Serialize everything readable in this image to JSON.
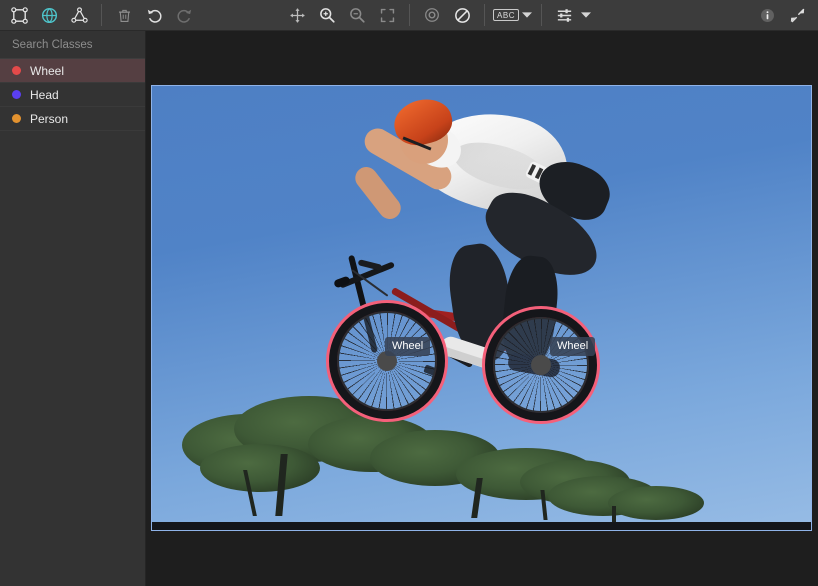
{
  "toolbar": {
    "left_tools": [
      {
        "name": "bounding-box-tool-icon",
        "title": "Bounding Box",
        "active": false
      },
      {
        "name": "polygon-brush-tool-icon",
        "title": "Magic / Auto Segment",
        "active": true
      },
      {
        "name": "polygon-tool-icon",
        "title": "Polygon",
        "active": false
      },
      {
        "name": "delete-icon",
        "title": "Delete",
        "active": false
      },
      {
        "name": "undo-icon",
        "title": "Undo",
        "active": false
      },
      {
        "name": "redo-icon",
        "title": "Redo",
        "active": false
      }
    ],
    "center_tools": [
      {
        "name": "pan-move-icon",
        "title": "Pan"
      },
      {
        "name": "zoom-in-icon",
        "title": "Zoom In"
      },
      {
        "name": "zoom-out-icon",
        "title": "Zoom Out"
      },
      {
        "name": "fit-to-screen-icon",
        "title": "Fit To Screen"
      },
      {
        "name": "vertex-visibility-icon",
        "title": "Vertices"
      },
      {
        "name": "hide-annotations-icon",
        "title": "Hide Annotations"
      }
    ],
    "label_toggle": {
      "name": "abc-label-toggle",
      "text": "ABC"
    },
    "settings_toggle": {
      "name": "display-settings-icon"
    },
    "right_tools": [
      {
        "name": "info-icon",
        "title": "Info"
      },
      {
        "name": "expand-icon",
        "title": "Fullscreen"
      }
    ]
  },
  "sidebar": {
    "search": {
      "placeholder": "Search Classes",
      "value": ""
    },
    "classes": [
      {
        "label": "Wheel",
        "color": "#e34a4a",
        "selected": true
      },
      {
        "label": "Head",
        "color": "#5b3ff0",
        "selected": false
      },
      {
        "label": "Person",
        "color": "#e3922f",
        "selected": false
      }
    ]
  },
  "canvas": {
    "annotations": [
      {
        "id": "wheel-front",
        "label": "Wheel",
        "class_color": "#f4607a",
        "shape": "ellipse"
      },
      {
        "id": "wheel-rear",
        "label": "Wheel",
        "class_color": "#f4607a",
        "shape": "ellipse"
      }
    ],
    "image_alt": "BMX rider mid-air jump against blue sky with pine trees"
  }
}
